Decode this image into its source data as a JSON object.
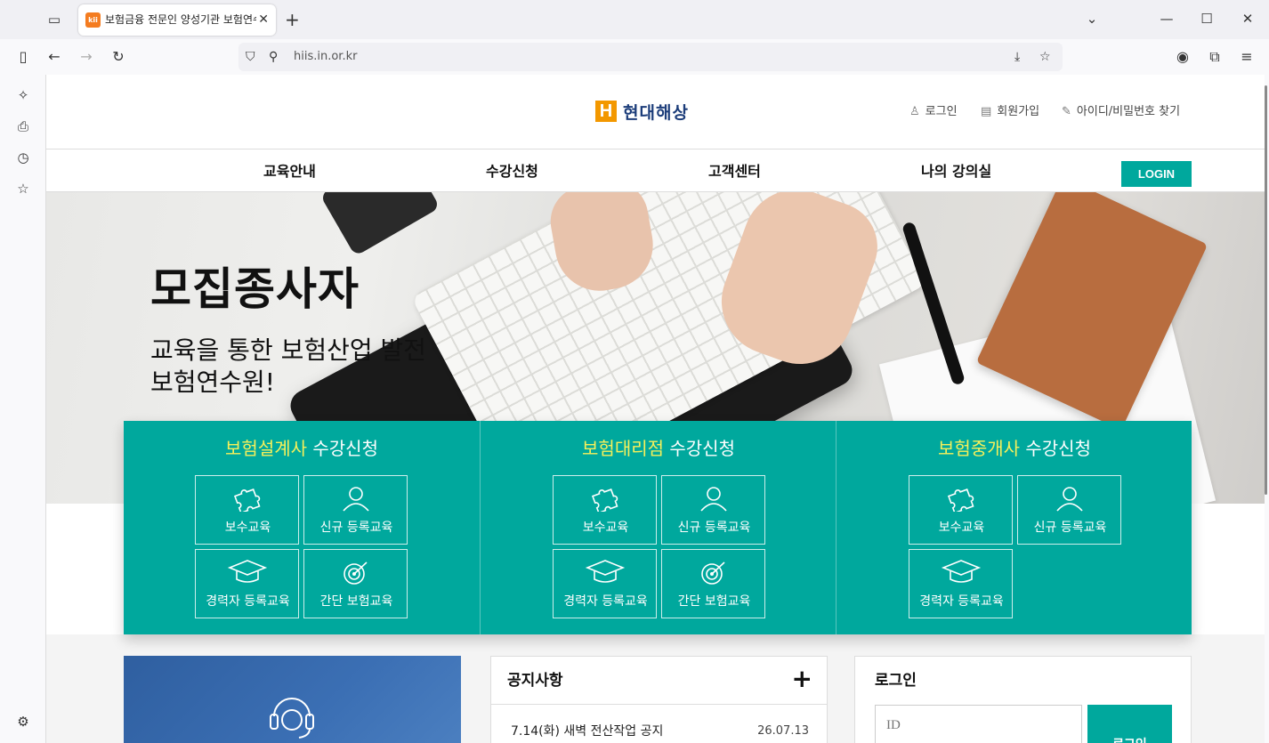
{
  "browser": {
    "tab_title": "보험금융 전문인 양성기관 보험연수원",
    "tab_favicon_text": "kii",
    "url": "hiis.in.or.kr",
    "icons": [
      "tab-list-icon",
      "close-icon",
      "plus-icon",
      "chevron-down-icon",
      "minimize-icon",
      "maximize-icon",
      "close-window-icon",
      "sidebar-toggle-icon",
      "back-icon",
      "forward-icon",
      "reload-icon",
      "shield-icon",
      "permissions-icon",
      "download-icon",
      "star-icon",
      "account-icon",
      "extensions-icon",
      "menu-icon"
    ]
  },
  "header": {
    "logo_mark": "H",
    "logo_text": "현대해상",
    "util": {
      "login": "로그인",
      "signup": "회원가입",
      "find": "아이디/비밀번호 찾기"
    }
  },
  "gnb": {
    "items": [
      "교육안내",
      "수강신청",
      "고객센터",
      "나의 강의실"
    ],
    "login_button": "LOGIN"
  },
  "hero": {
    "title": "모집종사자",
    "subtitle_line1": "교육을 통한 보험산업 발전",
    "subtitle_line2": "보험연수원!"
  },
  "courses": [
    {
      "highlight": "보험설계사",
      "suffix": " 수강신청",
      "items": [
        "보수교육",
        "신규 등록교육",
        "경력자 등록교육",
        "간단 보험교육"
      ]
    },
    {
      "highlight": "보험대리점",
      "suffix": " 수강신청",
      "items": [
        "보수교육",
        "신규 등록교육",
        "경력자 등록교육",
        "간단 보험교육"
      ]
    },
    {
      "highlight": "보험중개사",
      "suffix": " 수강신청",
      "items": [
        "보수교육",
        "신규 등록교육",
        "경력자 등록교육"
      ]
    }
  ],
  "notice": {
    "title": "공지사항",
    "more": "+",
    "rows": [
      {
        "title": "7.14(화) 새벽 전산작업 공지",
        "date": "26.07.13"
      }
    ]
  },
  "login_box": {
    "title": "로그인",
    "id_placeholder": "ID",
    "submit": "로그인"
  },
  "colors": {
    "accent": "#00a89d",
    "highlight": "#f6f05a",
    "logo_orange": "#f39800",
    "logo_navy": "#1c3d7a"
  }
}
